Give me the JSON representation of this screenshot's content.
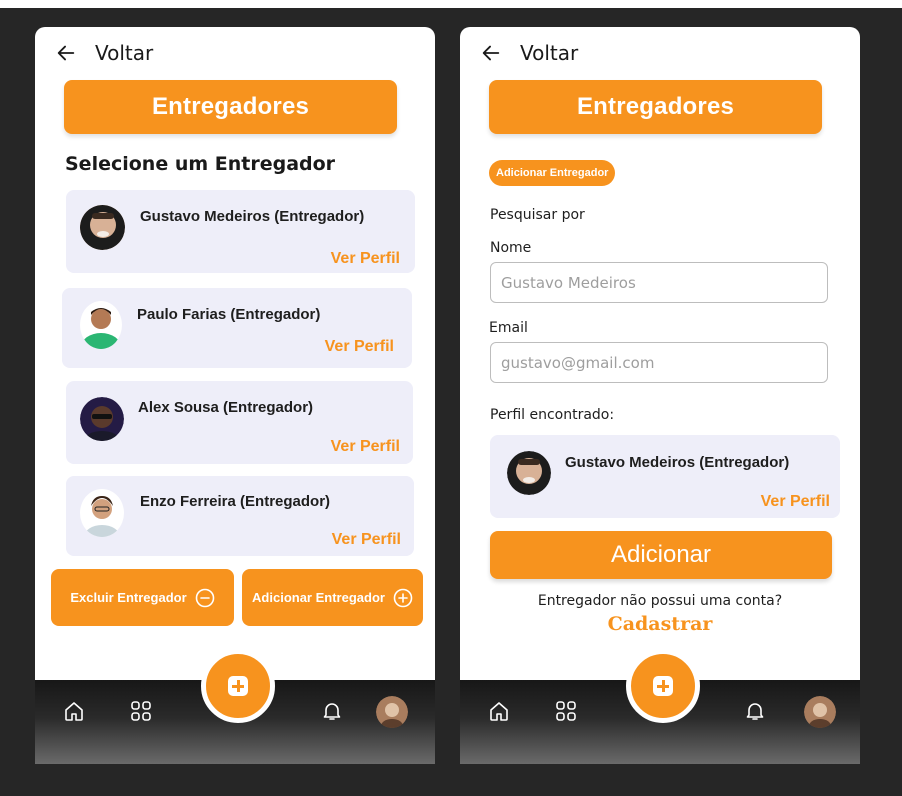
{
  "colors": {
    "accent": "#f7931e",
    "card_bg": "#eeeef9",
    "page_bg": "#262626",
    "nav_bg": "#171717"
  },
  "screen1": {
    "back_label": "Voltar",
    "title": "Entregadores",
    "section_heading": "Selecione um Entregador",
    "couriers": [
      {
        "name": "Gustavo Medeiros (Entregador)",
        "link": "Ver Perfil"
      },
      {
        "name": "Paulo Farias (Entregador)",
        "link": "Ver Perfil"
      },
      {
        "name": "Alex Sousa (Entregador)",
        "link": "Ver Perfil"
      },
      {
        "name": "Enzo Ferreira (Entregador)",
        "link": "Ver Perfil"
      }
    ],
    "delete_button": "Excluir Entregador",
    "add_button": "Adicionar Entregador"
  },
  "screen2": {
    "back_label": "Voltar",
    "title": "Entregadores",
    "chip_label": "Adicionar Entregador",
    "search_by_label": "Pesquisar por",
    "name_label": "Nome",
    "name_placeholder": "Gustavo Medeiros",
    "email_label": "Email",
    "email_placeholder": "gustavo@gmail.com",
    "found_label": "Perfil encontrado:",
    "found_profile": {
      "name": "Gustavo Medeiros (Entregador)",
      "link": "Ver Perfil"
    },
    "add_button": "Adicionar",
    "no_account_text": "Entregador não possui uma conta?",
    "register_link": "Cadastrar"
  },
  "nav": {
    "icons": [
      "home-icon",
      "grid-icon",
      "plus-icon",
      "bell-icon",
      "avatar"
    ]
  }
}
